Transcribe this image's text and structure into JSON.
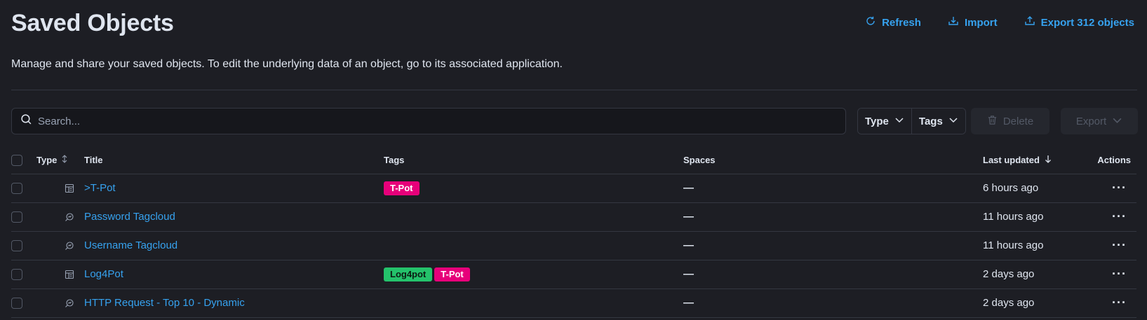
{
  "header": {
    "title": "Saved Objects",
    "refresh_label": "Refresh",
    "import_label": "Import",
    "export_all_label": "Export 312 objects",
    "description": "Manage and share your saved objects. To edit the underlying data of an object, go to its associated application."
  },
  "toolbar": {
    "search_placeholder": "Search...",
    "type_filter_label": "Type",
    "tags_filter_label": "Tags",
    "delete_label": "Delete",
    "export_label": "Export"
  },
  "table": {
    "columns": {
      "type": "Type",
      "title": "Title",
      "tags": "Tags",
      "spaces": "Spaces",
      "last_updated": "Last updated",
      "actions": "Actions"
    },
    "rows": [
      {
        "type_icon": "dashboard-icon",
        "title": ">T-Pot",
        "tags": [
          {
            "label": "T-Pot",
            "color": "#e7007a",
            "text": "#ffffff"
          }
        ],
        "spaces": "—",
        "last_updated": "6 hours ago"
      },
      {
        "type_icon": "visualization-icon",
        "title": "Password Tagcloud",
        "tags": [],
        "spaces": "—",
        "last_updated": "11 hours ago"
      },
      {
        "type_icon": "visualization-icon",
        "title": "Username Tagcloud",
        "tags": [],
        "spaces": "—",
        "last_updated": "11 hours ago"
      },
      {
        "type_icon": "dashboard-icon",
        "title": "Log4Pot",
        "tags": [
          {
            "label": "Log4pot",
            "color": "#24c26b",
            "text": "#0b1b12"
          },
          {
            "label": "T-Pot",
            "color": "#e7007a",
            "text": "#ffffff"
          }
        ],
        "spaces": "—",
        "last_updated": "2 days ago"
      },
      {
        "type_icon": "visualization-icon",
        "title": "HTTP Request - Top 10 - Dynamic",
        "tags": [],
        "spaces": "—",
        "last_updated": "2 days ago"
      }
    ]
  },
  "colors": {
    "background": "#1d1e24",
    "link": "#36a2ef",
    "border": "#343741"
  }
}
